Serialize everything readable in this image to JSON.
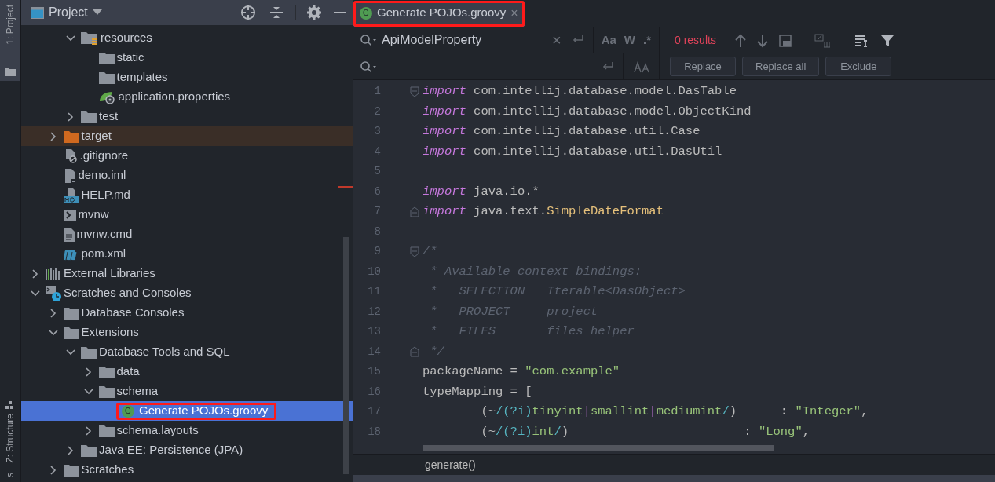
{
  "tool_stripe": {
    "top": [
      {
        "label": "1: Project",
        "selected": true
      }
    ],
    "bottom": [
      {
        "label": "Z: Structure",
        "selected": false
      },
      {
        "label": "s",
        "selected": false
      }
    ]
  },
  "project_panel": {
    "title": "Project",
    "tree": [
      {
        "children": [
          {
            "children": [
              {
                "label": "resources",
                "kind": "resources-folder",
                "expanded": true,
                "selected": false,
                "children": [
                  {
                    "label": "static",
                    "kind": "folder",
                    "selected": false
                  },
                  {
                    "label": "templates",
                    "kind": "folder",
                    "selected": false
                  },
                  {
                    "label": "application.properties",
                    "kind": "spring",
                    "selected": false
                  }
                ]
              },
              {
                "label": "test",
                "kind": "folder",
                "expanded": false,
                "selected": false
              }
            ]
          },
          {
            "label": "target",
            "kind": "excluded-folder",
            "expanded": false,
            "selected": false
          },
          {
            "label": ".gitignore",
            "kind": "ignore-file",
            "selected": false
          },
          {
            "label": "demo.iml",
            "kind": "iml-file",
            "selected": false
          },
          {
            "label": "HELP.md",
            "kind": "md-file",
            "selected": false
          },
          {
            "label": "mvnw",
            "kind": "shell-file",
            "selected": false
          },
          {
            "label": "mvnw.cmd",
            "kind": "text-file",
            "selected": false
          },
          {
            "label": "pom.xml",
            "kind": "maven-file",
            "selected": false
          }
        ]
      },
      {
        "label": "External Libraries",
        "kind": "libraries",
        "expanded": false,
        "selected": false
      },
      {
        "label": "Scratches and Consoles",
        "kind": "scratches",
        "expanded": true,
        "selected": false,
        "children": [
          {
            "label": "Database Consoles",
            "kind": "folder",
            "expanded": false,
            "selected": false
          },
          {
            "label": "Extensions",
            "kind": "folder",
            "expanded": true,
            "selected": false,
            "children": [
              {
                "label": "Database Tools and SQL",
                "kind": "folder",
                "expanded": true,
                "selected": false,
                "children": [
                  {
                    "label": "data",
                    "kind": "folder",
                    "expanded": false,
                    "selected": false
                  },
                  {
                    "label": "schema",
                    "kind": "folder",
                    "expanded": true,
                    "selected": false,
                    "children": [
                      {
                        "label": "Generate POJOs.groovy",
                        "kind": "groovy-file",
                        "icon_letter": "G",
                        "selected": true,
                        "highlighted": true
                      }
                    ]
                  },
                  {
                    "label": "schema.layouts",
                    "kind": "folder",
                    "expanded": false,
                    "selected": false
                  }
                ]
              },
              {
                "label": "Java EE: Persistence (JPA)",
                "kind": "folder",
                "expanded": false,
                "selected": false
              }
            ]
          },
          {
            "label": "Scratches",
            "kind": "folder",
            "expanded": false,
            "selected": false
          }
        ]
      }
    ]
  },
  "editor_tabs": [
    {
      "label": "Generate POJOs.groovy",
      "icon_letter": "G",
      "selected": true,
      "highlighted": true,
      "close": "×"
    }
  ],
  "find_replace": {
    "search_value": "ApiModelProperty",
    "close": "×",
    "match_case": "Aa",
    "words": "W",
    "regex": ".*",
    "results": "0 results",
    "buttons": [
      "Replace",
      "Replace all",
      "Exclude"
    ]
  },
  "code": {
    "lines": [
      {
        "number": "1",
        "fold_start": true,
        "tokens": [
          {
            "kind": "kw",
            "text": "import"
          },
          {
            "kind": "plain",
            "text": " com.intellij.database.model.DasTable"
          }
        ]
      },
      {
        "number": "2",
        "tokens": [
          {
            "kind": "kw",
            "text": "import"
          },
          {
            "kind": "plain",
            "text": " com.intellij.database.model.ObjectKind"
          }
        ]
      },
      {
        "number": "3",
        "tokens": [
          {
            "kind": "kw",
            "text": "import"
          },
          {
            "kind": "plain",
            "text": " com.intellij.database.util.Case"
          }
        ]
      },
      {
        "number": "4",
        "tokens": [
          {
            "kind": "kw",
            "text": "import"
          },
          {
            "kind": "plain",
            "text": " com.intellij.database.util.DasUtil"
          }
        ]
      },
      {
        "number": "5"
      },
      {
        "number": "6",
        "tokens": [
          {
            "kind": "kw",
            "text": "import"
          },
          {
            "kind": "plain",
            "text": " java.io.*"
          }
        ]
      },
      {
        "number": "7",
        "fold_end": true,
        "tokens": [
          {
            "kind": "kw",
            "text": "import"
          },
          {
            "kind": "plain",
            "text": " java.text."
          },
          {
            "kind": "class",
            "text": "SimpleDateFormat"
          }
        ]
      },
      {
        "number": "8"
      },
      {
        "number": "9",
        "fold_start": true,
        "tokens": [
          {
            "kind": "comment",
            "text": "/*"
          }
        ]
      },
      {
        "number": "10",
        "tokens": [
          {
            "kind": "comment",
            "text": " * Available context bindings:"
          }
        ]
      },
      {
        "number": "11",
        "tokens": [
          {
            "kind": "comment",
            "text": " *   SELECTION   Iterable<DasObject>"
          }
        ]
      },
      {
        "number": "12",
        "tokens": [
          {
            "kind": "comment",
            "text": " *   PROJECT     project"
          }
        ]
      },
      {
        "number": "13",
        "tokens": [
          {
            "kind": "comment",
            "text": " *   FILES       files helper"
          }
        ]
      },
      {
        "number": "14",
        "fold_end": true,
        "tokens": [
          {
            "kind": "comment",
            "text": " */"
          }
        ]
      },
      {
        "number": "15",
        "tokens": [
          {
            "kind": "plain",
            "text": "packageName = "
          },
          {
            "kind": "string",
            "text": "\"com.example\""
          }
        ]
      },
      {
        "number": "16",
        "tokens": [
          {
            "kind": "plain",
            "text": "typeMapping = ["
          }
        ]
      },
      {
        "number": "17",
        "tokens": [
          {
            "kind": "plain",
            "text": "        (~"
          },
          {
            "kind": "regex",
            "text": "/(?i)"
          },
          {
            "kind": "string",
            "text": "tinyint"
          },
          {
            "kind": "pipe",
            "text": "|"
          },
          {
            "kind": "string",
            "text": "smallint"
          },
          {
            "kind": "pipe",
            "text": "|"
          },
          {
            "kind": "string",
            "text": "mediumint"
          },
          {
            "kind": "regex",
            "text": "/"
          },
          {
            "kind": "plain",
            "text": ")      : "
          },
          {
            "kind": "string",
            "text": "\"Integer\""
          },
          {
            "kind": "plain",
            "text": ","
          }
        ]
      },
      {
        "number": "18",
        "tokens": [
          {
            "kind": "plain",
            "text": "        (~"
          },
          {
            "kind": "regex",
            "text": "/(?i)"
          },
          {
            "kind": "string",
            "text": "int"
          },
          {
            "kind": "regex",
            "text": "/"
          },
          {
            "kind": "plain",
            "text": ")                        : "
          },
          {
            "kind": "string",
            "text": "\"Long\""
          },
          {
            "kind": "plain",
            "text": ","
          }
        ]
      }
    ]
  },
  "breadcrumb": "generate()"
}
